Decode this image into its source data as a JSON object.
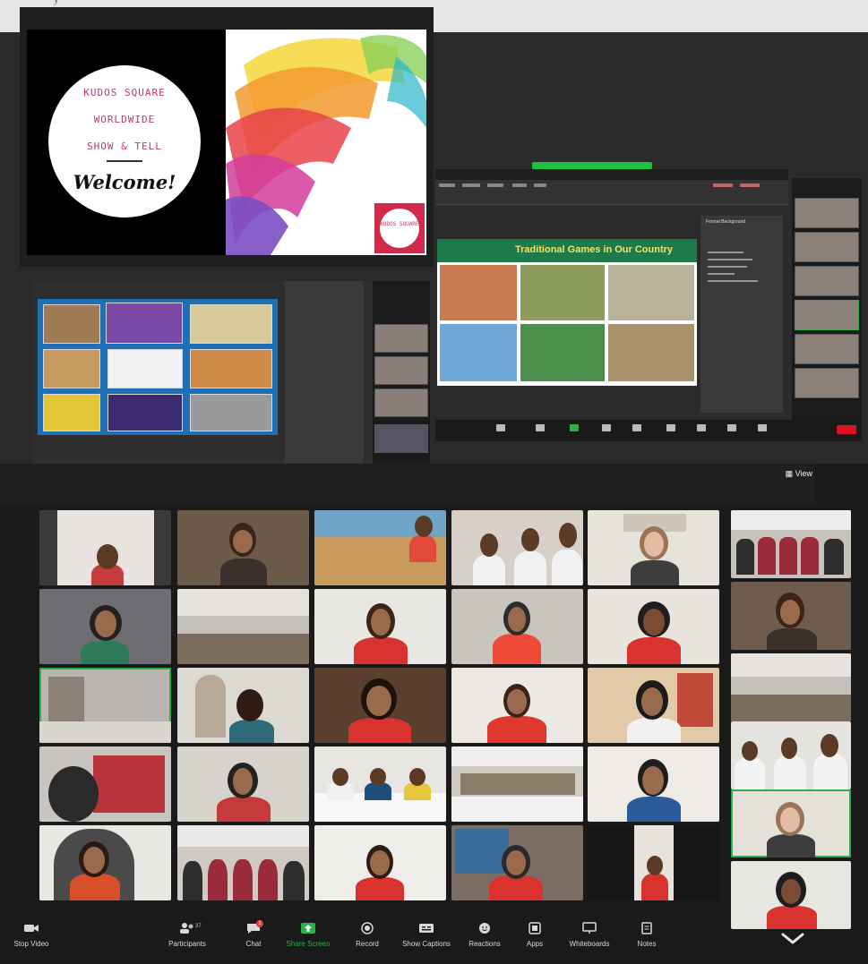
{
  "page": {
    "top_caption": "y"
  },
  "welcome_slide": {
    "lines": [
      "KUDOS SQUARE",
      "WORLDWIDE",
      "SHOW & TELL"
    ],
    "title": "Welcome!",
    "badge_text": "KUDOS SQUARE"
  },
  "ppt_window": {
    "slide_title": "Traditional Games in Our Country",
    "panel_title": "Format Background"
  },
  "meeting": {
    "view_label": "View",
    "toolbar": {
      "stop_video": "Stop Video",
      "participants": "Participants",
      "participants_count": "37",
      "chat": "Chat",
      "chat_badge": "1",
      "share_screen": "Share Screen",
      "record": "Record",
      "show_captions": "Show Captions",
      "reactions": "Reactions",
      "apps": "Apps",
      "whiteboards": "Whiteboards",
      "notes": "Notes"
    }
  },
  "colors": {
    "zoom_green": "#27b24a",
    "brand_pink": "#c0395a",
    "slide_green": "#1e7a4a",
    "slide_title_yellow": "#f3e36b"
  },
  "icons": [
    "video-camera-icon",
    "participants-icon",
    "chat-icon",
    "share-screen-icon",
    "record-icon",
    "captions-icon",
    "reactions-icon",
    "apps-icon",
    "whiteboard-icon",
    "notes-icon",
    "chevron-down-icon",
    "grid-view-icon"
  ]
}
